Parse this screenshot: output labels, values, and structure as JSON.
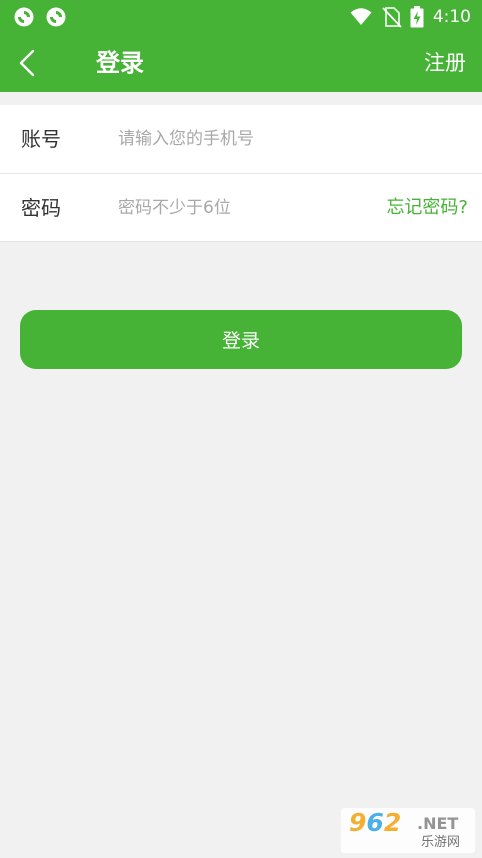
{
  "status_bar": {
    "time": "4:10",
    "icons": [
      "sync-icon",
      "sync-icon",
      "wifi-icon",
      "no-sim-icon",
      "battery-charging-icon"
    ]
  },
  "app_bar": {
    "back_icon": "chevron-left-icon",
    "title": "登录",
    "register_label": "注册"
  },
  "form": {
    "account": {
      "label": "账号",
      "value": "",
      "placeholder": "请输入您的手机号"
    },
    "password": {
      "label": "密码",
      "value": "",
      "placeholder": "密码不少于6位",
      "forgot_label": "忘记密码?"
    }
  },
  "login_button": {
    "label": "登录"
  },
  "watermark": {
    "logo_digits": [
      "9",
      "6",
      "2"
    ],
    "logo_suffix": ".NET",
    "subtitle": "乐游网"
  },
  "colors": {
    "brand_green": "#46b236",
    "background": "#f1f1f1",
    "placeholder": "#a8a8a8"
  }
}
